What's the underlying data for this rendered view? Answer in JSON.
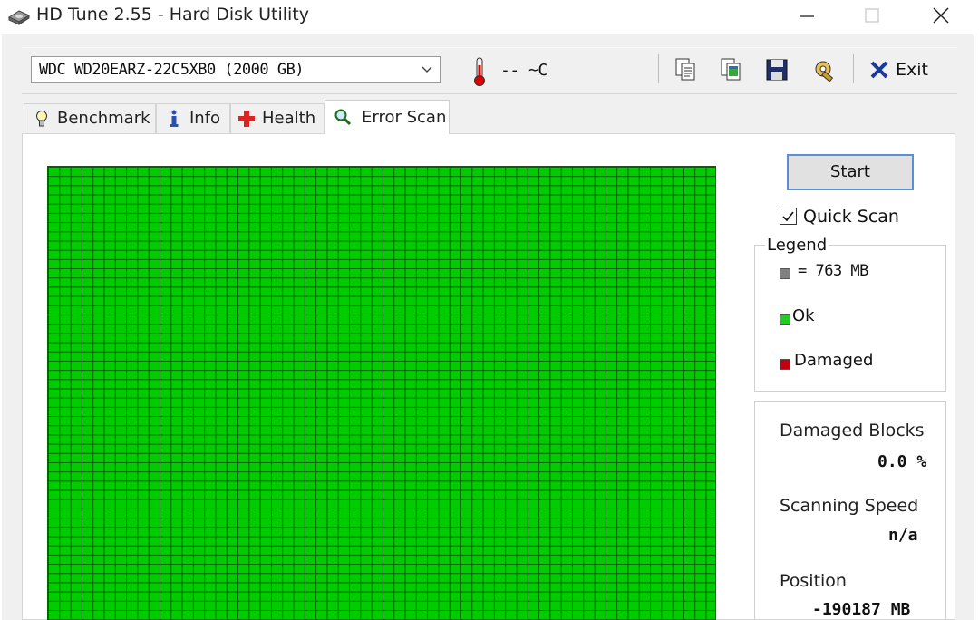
{
  "window": {
    "title": "HD Tune 2.55 - Hard Disk Utility"
  },
  "toolbar": {
    "drive": "WDC WD20EARZ-22C5XB0 (2000 GB)",
    "temperature": "-- ~C",
    "exit_label": "Exit",
    "icons": [
      "copy-text-icon",
      "copy-screenshot-icon",
      "save-icon",
      "options-icon"
    ]
  },
  "tabs": [
    {
      "label": "Benchmark",
      "icon": "lightbulb-icon"
    },
    {
      "label": "Info",
      "icon": "info-icon"
    },
    {
      "label": "Health",
      "icon": "health-cross-icon"
    },
    {
      "label": "Error Scan",
      "icon": "magnifier-icon",
      "active": true
    }
  ],
  "scan": {
    "start_label": "Start",
    "quick_scan_label": "Quick Scan",
    "quick_scan_checked": true
  },
  "legend": {
    "title": "Legend",
    "block_size": "= 763 MB",
    "ok_label": "Ok",
    "damaged_label": "Damaged",
    "colors": {
      "block": "#808080",
      "ok": "#22cc22",
      "damaged": "#c0000f"
    }
  },
  "stats": {
    "damaged_blocks_label": "Damaged Blocks",
    "damaged_blocks_value": "0.0 %",
    "scanning_speed_label": "Scanning Speed",
    "scanning_speed_value": "n/a",
    "position_label": "Position",
    "position_value": "-190187 MB"
  },
  "colors": {
    "grid_fill": "#00cc00",
    "grid_line": "#006400",
    "start_border": "#5a8fd8"
  }
}
